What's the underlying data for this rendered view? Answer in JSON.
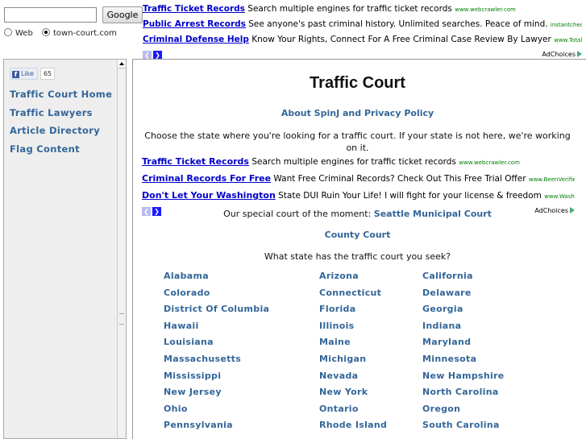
{
  "search": {
    "input_value": "",
    "button_label": "Google",
    "scope_options": [
      "Web",
      "town-court.com"
    ],
    "selected_scope": "town-court.com"
  },
  "top_ads": [
    {
      "title": "Traffic Ticket Records",
      "text": "Search multiple engines for traffic ticket records",
      "url": "www.webcrawler.com"
    },
    {
      "title": "Public Arrest Records",
      "text": "See anyone's past criminal history. Unlimited searches. Peace of mind.",
      "url": "instantcheckmate.com"
    },
    {
      "title": "Criminal Defense Help",
      "text": "Know Your Rights, Connect For A Free Criminal Case Review By Lawyer",
      "url": "www.TotalCriminalDefense.com"
    }
  ],
  "adchoices_label": "AdChoices",
  "sidebar": {
    "like_label": "Like",
    "like_count": "65",
    "links": [
      "Traffic Court Home",
      "Traffic Lawyers",
      "Article Directory",
      "Flag Content"
    ]
  },
  "main": {
    "title": "Traffic Court",
    "about_link": "About SpinJ and Privacy Policy",
    "intro": "Choose the state where you're looking for a traffic court. If your state is not here, we're working on it.",
    "ads": [
      {
        "title": "Traffic Ticket Records",
        "text": "Search multiple engines for traffic ticket records",
        "url": "www.webcrawler.com"
      },
      {
        "title": "Criminal Records For Free",
        "text": "Want Free Criminal Records? Check Out This Free Trial Offer",
        "url": "www.BeenVerified.com"
      },
      {
        "title": "Don't Let Your Washington",
        "text": "State DUI Ruin Your Life! I will fight for your license & freedom",
        "url": "www.Washington-DUI.com"
      }
    ],
    "special_prefix": "Our special court of the moment:",
    "special_court": "Seattle Municipal Court",
    "county_link": "County Court",
    "question": "What state has the traffic court you seek?",
    "states": [
      [
        "Alabama",
        "Arizona",
        "California"
      ],
      [
        "Colorado",
        "Connecticut",
        "Delaware"
      ],
      [
        "District Of Columbia",
        "Florida",
        "Georgia"
      ],
      [
        "Hawaii",
        "Illinois",
        "Indiana"
      ],
      [
        "Louisiana",
        "Maine",
        "Maryland"
      ],
      [
        "Massachusetts",
        "Michigan",
        "Minnesota"
      ],
      [
        "Mississippi",
        "Nevada",
        "New Hampshire"
      ],
      [
        "New Jersey",
        "New York",
        "North Carolina"
      ],
      [
        "Ohio",
        "Ontario",
        "Oregon"
      ],
      [
        "Pennsylvania",
        "Rhode Island",
        "South Carolina"
      ]
    ]
  },
  "colors": {
    "link": "#336699",
    "ad_title": "#0000cc",
    "ad_url": "#008000",
    "sidebar_bg": "#eeeeee"
  }
}
